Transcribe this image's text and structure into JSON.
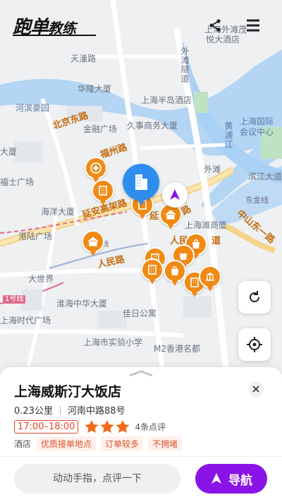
{
  "header": {
    "logo_main": "跑单",
    "logo_sub": "教练",
    "share_icon": "share-icon",
    "menu_icon": "menu-icon"
  },
  "map": {
    "labels": {
      "waitan_hotel": "上海外滩茂",
      "yuedahotel": "悦大酒店",
      "tiantong": "天潼路",
      "hualong": "华隆大厦",
      "hehanhaoyuan": "河滨豪园",
      "bandao": "上海半岛酒店",
      "waitan_tunnel": "外滩隧道",
      "beijing_east": "北京东路",
      "jinguang": "金融广场",
      "jiushi": "久事商务大厦",
      "huangpu": "黄浦江",
      "intl_conf": "上海国际会议中心",
      "fuzhou": "福州路",
      "dasha": "大厦",
      "fushi": "福士广场",
      "waitan": "外滩",
      "binjiang": "滨江大道",
      "haiyang": "海洋大厦",
      "yanan": "延安高架路",
      "yan": "延",
      "dongjin": "东金线",
      "zhongshan": "中山东一路",
      "ganglu": "港陆广场",
      "weifang": "上海滩商厦",
      "renmin_road": "人民路",
      "daShijie": "大世界",
      "huaihai": "淮海中华大厦",
      "jiatian": "佳日公寓",
      "timeSquare": "上海时代广场",
      "experiment": "上海市实验小学",
      "hongkong": "M2香港名都",
      "line1": "1号线",
      "line4": "4号线",
      "renmin2": "人民",
      "dao": "道",
      "road2": "路"
    }
  },
  "card": {
    "name": "上海威斯汀大饭店",
    "distance": "0.23公里",
    "address": "河南中路88号",
    "hours": "17:00–18:00",
    "rating": 3,
    "reviews": "4条点评",
    "category": "酒店",
    "tags": [
      "优质接单地点",
      "订单较多",
      "不拥堵"
    ],
    "comment_placeholder": "动动手指，点评一下",
    "navigate_label": "导航"
  },
  "colors": {
    "accent_purple": "#8a14e8",
    "pin_orange": "#f08a14",
    "pin_blue": "#2d8ef0",
    "hours_red": "#e5482d",
    "star_orange": "#f26a1b"
  }
}
